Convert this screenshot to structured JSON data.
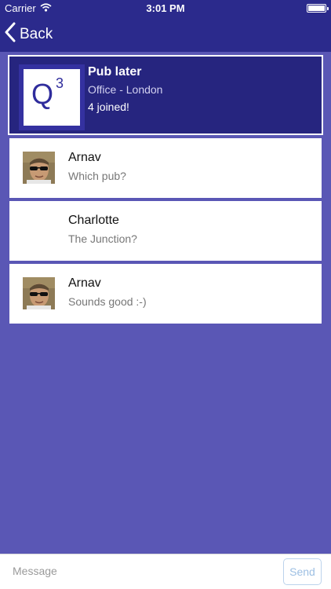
{
  "status_bar": {
    "carrier": "Carrier",
    "time": "3:01 PM"
  },
  "nav": {
    "back_label": "Back"
  },
  "event": {
    "title": "Pub later",
    "location": "Office - London",
    "joined": "4 joined!",
    "logo_letter": "Q",
    "logo_superscript": "3"
  },
  "messages": [
    {
      "sender": "Arnav",
      "text": "Which pub?",
      "has_avatar": true
    },
    {
      "sender": "Charlotte",
      "text": "The Junction?",
      "has_avatar": false
    },
    {
      "sender": "Arnav",
      "text": "Sounds good :-)",
      "has_avatar": true
    }
  ],
  "compose": {
    "placeholder": "Message",
    "send_label": "Send"
  },
  "colors": {
    "nav_background": "#2b2a8c",
    "page_background": "#5a57b5",
    "header_card_background": "#26257f",
    "send_text": "#9dbfe3"
  }
}
